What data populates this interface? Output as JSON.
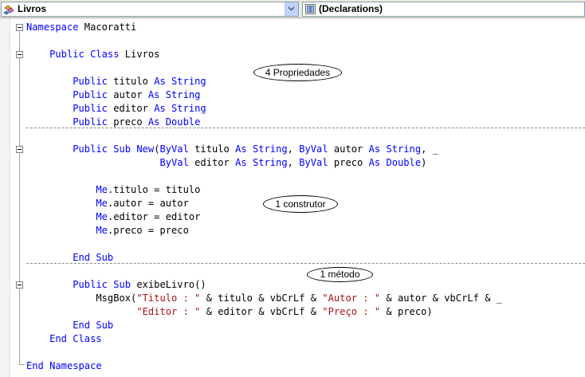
{
  "toolbar": {
    "class_selector": {
      "value": "Livros",
      "icon": "class-icon"
    },
    "member_selector": {
      "value": "(Declarations)",
      "icon": "declarations-icon"
    }
  },
  "code": {
    "lines": [
      [
        {
          "t": "Namespace",
          "k": "kw"
        },
        {
          "t": " Macoratti"
        }
      ],
      [],
      [
        {
          "t": "    "
        },
        {
          "t": "Public",
          "k": "kw"
        },
        {
          "t": " "
        },
        {
          "t": "Class",
          "k": "kw"
        },
        {
          "t": " Livros"
        }
      ],
      [],
      [
        {
          "t": "        "
        },
        {
          "t": "Public",
          "k": "kw"
        },
        {
          "t": " titulo "
        },
        {
          "t": "As",
          "k": "kw"
        },
        {
          "t": " "
        },
        {
          "t": "String",
          "k": "kw"
        }
      ],
      [
        {
          "t": "        "
        },
        {
          "t": "Public",
          "k": "kw"
        },
        {
          "t": " autor "
        },
        {
          "t": "As",
          "k": "kw"
        },
        {
          "t": " "
        },
        {
          "t": "String",
          "k": "kw"
        }
      ],
      [
        {
          "t": "        "
        },
        {
          "t": "Public",
          "k": "kw"
        },
        {
          "t": " editor "
        },
        {
          "t": "As",
          "k": "kw"
        },
        {
          "t": " "
        },
        {
          "t": "String",
          "k": "kw"
        }
      ],
      [
        {
          "t": "        "
        },
        {
          "t": "Public",
          "k": "kw"
        },
        {
          "t": " preco "
        },
        {
          "t": "As",
          "k": "kw"
        },
        {
          "t": " "
        },
        {
          "t": "Double",
          "k": "kw"
        }
      ],
      [],
      [
        {
          "t": "        "
        },
        {
          "t": "Public",
          "k": "kw"
        },
        {
          "t": " "
        },
        {
          "t": "Sub",
          "k": "kw"
        },
        {
          "t": " "
        },
        {
          "t": "New",
          "k": "kw"
        },
        {
          "t": "("
        },
        {
          "t": "ByVal",
          "k": "kw"
        },
        {
          "t": " titulo "
        },
        {
          "t": "As",
          "k": "kw"
        },
        {
          "t": " "
        },
        {
          "t": "String",
          "k": "kw"
        },
        {
          "t": ", "
        },
        {
          "t": "ByVal",
          "k": "kw"
        },
        {
          "t": " autor "
        },
        {
          "t": "As",
          "k": "kw"
        },
        {
          "t": " "
        },
        {
          "t": "String",
          "k": "kw"
        },
        {
          "t": ", _"
        }
      ],
      [
        {
          "t": "                       "
        },
        {
          "t": "ByVal",
          "k": "kw"
        },
        {
          "t": " editor "
        },
        {
          "t": "As",
          "k": "kw"
        },
        {
          "t": " "
        },
        {
          "t": "String",
          "k": "kw"
        },
        {
          "t": ", "
        },
        {
          "t": "ByVal",
          "k": "kw"
        },
        {
          "t": " preco "
        },
        {
          "t": "As",
          "k": "kw"
        },
        {
          "t": " "
        },
        {
          "t": "Double",
          "k": "kw"
        },
        {
          "t": ")"
        }
      ],
      [],
      [
        {
          "t": "            "
        },
        {
          "t": "Me",
          "k": "kw"
        },
        {
          "t": ".titulo = titulo"
        }
      ],
      [
        {
          "t": "            "
        },
        {
          "t": "Me",
          "k": "kw"
        },
        {
          "t": ".autor = autor"
        }
      ],
      [
        {
          "t": "            "
        },
        {
          "t": "Me",
          "k": "kw"
        },
        {
          "t": ".editor = editor"
        }
      ],
      [
        {
          "t": "            "
        },
        {
          "t": "Me",
          "k": "kw"
        },
        {
          "t": ".preco = preco"
        }
      ],
      [],
      [
        {
          "t": "        "
        },
        {
          "t": "End",
          "k": "kw"
        },
        {
          "t": " "
        },
        {
          "t": "Sub",
          "k": "kw"
        }
      ],
      [],
      [
        {
          "t": "        "
        },
        {
          "t": "Public",
          "k": "kw"
        },
        {
          "t": " "
        },
        {
          "t": "Sub",
          "k": "kw"
        },
        {
          "t": " exibeLivro()"
        }
      ],
      [
        {
          "t": "            MsgBox("
        },
        {
          "t": "\"Titulo : \"",
          "k": "str"
        },
        {
          "t": " & titulo & vbCrLf & "
        },
        {
          "t": "\"Autor : \"",
          "k": "str"
        },
        {
          "t": " & autor & vbCrLf & _"
        }
      ],
      [
        {
          "t": "                   "
        },
        {
          "t": "\"Editor : \"",
          "k": "str"
        },
        {
          "t": " & editor & vbCrLf & "
        },
        {
          "t": "\"Preço : \"",
          "k": "str"
        },
        {
          "t": " & preco)"
        }
      ],
      [
        {
          "t": "        "
        },
        {
          "t": "End",
          "k": "kw"
        },
        {
          "t": " "
        },
        {
          "t": "Sub",
          "k": "kw"
        }
      ],
      [
        {
          "t": "    "
        },
        {
          "t": "End",
          "k": "kw"
        },
        {
          "t": " "
        },
        {
          "t": "Class",
          "k": "kw"
        }
      ],
      [],
      [
        {
          "t": "End",
          "k": "kw"
        },
        {
          "t": " "
        },
        {
          "t": "Namespace",
          "k": "kw"
        }
      ]
    ]
  },
  "annotations": {
    "properties": "4 Propriedades",
    "constructor": "1 construtor",
    "method": "1 método"
  },
  "colors": {
    "keyword": "#0000ff",
    "string": "#a31515"
  }
}
